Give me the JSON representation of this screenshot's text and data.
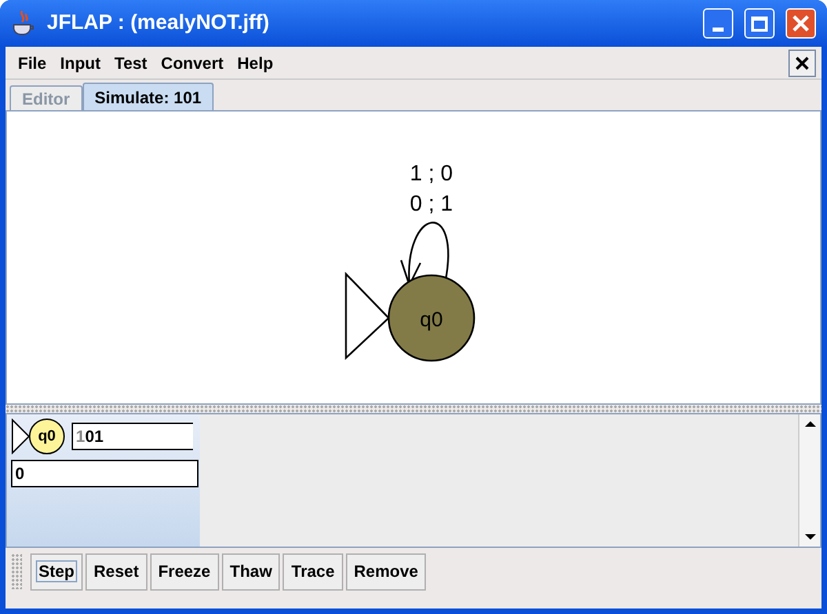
{
  "window": {
    "title": "JFLAP : (mealyNOT.jff)"
  },
  "menu": [
    "File",
    "Input",
    "Test",
    "Convert",
    "Help"
  ],
  "tabs": [
    {
      "label": "Editor",
      "selected": false,
      "disabled": true
    },
    {
      "label": "Simulate: 101",
      "selected": true,
      "disabled": false
    }
  ],
  "canvas": {
    "state": {
      "label": "q0",
      "initial": true
    },
    "transitions": [
      "1 ; 0",
      "0 ; 1"
    ]
  },
  "configuration": {
    "state": "q0",
    "consumed_input": "1",
    "remaining_input": "01",
    "output": "0"
  },
  "buttons": [
    {
      "label": "Step",
      "focused": true
    },
    {
      "label": "Reset",
      "focused": false
    },
    {
      "label": "Freeze",
      "focused": false
    },
    {
      "label": "Thaw",
      "focused": false
    },
    {
      "label": "Trace",
      "focused": false
    },
    {
      "label": "Remove",
      "focused": false
    }
  ]
}
